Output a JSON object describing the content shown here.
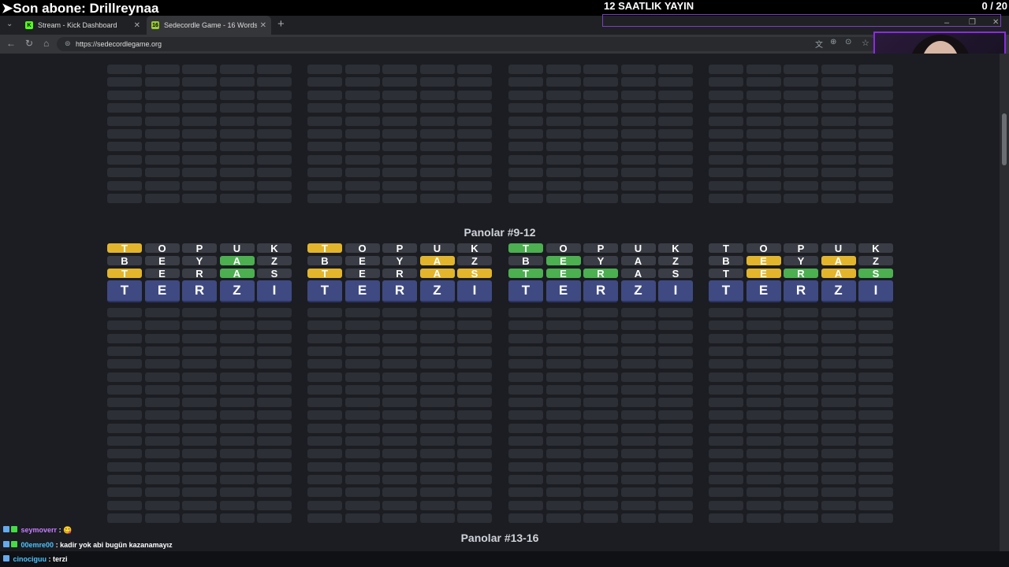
{
  "overlay": {
    "last_sub": "➤Son abone: Drillreynaa",
    "stream_title": "12 SAATLIK YAYIN",
    "counter": "0  / 20",
    "accent": "#8a2be2"
  },
  "browser": {
    "tabs": [
      {
        "label": "Stream - Kick Dashboard",
        "icon": "kick-icon",
        "favicon_text": "K",
        "active": false
      },
      {
        "label": "Sedecordle Game - 16 Words Wo",
        "icon": "sedecordle-icon",
        "favicon_text": "16",
        "active": true
      }
    ],
    "new_tab": "+",
    "url": "https://sedecordlegame.org"
  },
  "game": {
    "section_mid": "Panolar #9-12",
    "section_bottom": "Panolar #13-16",
    "boards": [
      {
        "rows": [
          [
            [
              "T",
              "y"
            ],
            [
              "O",
              "n"
            ],
            [
              "P",
              "n"
            ],
            [
              "U",
              "n"
            ],
            [
              "K",
              "n"
            ]
          ],
          [
            [
              "B",
              "n"
            ],
            [
              "E",
              "n"
            ],
            [
              "Y",
              "n"
            ],
            [
              "A",
              "g"
            ],
            [
              "Z",
              "n"
            ]
          ],
          [
            [
              "T",
              "y"
            ],
            [
              "E",
              "n"
            ],
            [
              "R",
              "n"
            ],
            [
              "A",
              "g"
            ],
            [
              "S",
              "n"
            ]
          ]
        ],
        "current": [
          "T",
          "E",
          "R",
          "Z",
          "I"
        ]
      },
      {
        "rows": [
          [
            [
              "T",
              "y"
            ],
            [
              "O",
              "n"
            ],
            [
              "P",
              "n"
            ],
            [
              "U",
              "n"
            ],
            [
              "K",
              "n"
            ]
          ],
          [
            [
              "B",
              "n"
            ],
            [
              "E",
              "n"
            ],
            [
              "Y",
              "n"
            ],
            [
              "A",
              "y"
            ],
            [
              "Z",
              "n"
            ]
          ],
          [
            [
              "T",
              "y"
            ],
            [
              "E",
              "n"
            ],
            [
              "R",
              "n"
            ],
            [
              "A",
              "y"
            ],
            [
              "S",
              "y"
            ]
          ]
        ],
        "current": [
          "T",
          "E",
          "R",
          "Z",
          "I"
        ]
      },
      {
        "rows": [
          [
            [
              "T",
              "g"
            ],
            [
              "O",
              "n"
            ],
            [
              "P",
              "n"
            ],
            [
              "U",
              "n"
            ],
            [
              "K",
              "n"
            ]
          ],
          [
            [
              "B",
              "n"
            ],
            [
              "E",
              "g"
            ],
            [
              "Y",
              "n"
            ],
            [
              "A",
              "n"
            ],
            [
              "Z",
              "n"
            ]
          ],
          [
            [
              "T",
              "g"
            ],
            [
              "E",
              "g"
            ],
            [
              "R",
              "g"
            ],
            [
              "A",
              "n"
            ],
            [
              "S",
              "n"
            ]
          ]
        ],
        "current": [
          "T",
          "E",
          "R",
          "Z",
          "I"
        ]
      },
      {
        "rows": [
          [
            [
              "T",
              "n"
            ],
            [
              "O",
              "n"
            ],
            [
              "P",
              "n"
            ],
            [
              "U",
              "n"
            ],
            [
              "K",
              "n"
            ]
          ],
          [
            [
              "B",
              "n"
            ],
            [
              "E",
              "y"
            ],
            [
              "Y",
              "n"
            ],
            [
              "A",
              "y"
            ],
            [
              "Z",
              "n"
            ]
          ],
          [
            [
              "T",
              "n"
            ],
            [
              "E",
              "y"
            ],
            [
              "R",
              "g"
            ],
            [
              "A",
              "y"
            ],
            [
              "S",
              "g"
            ]
          ]
        ],
        "current": [
          "T",
          "E",
          "R",
          "Z",
          "I"
        ]
      }
    ]
  },
  "chat": [
    {
      "user": "seymoverr",
      "message": ": 😋"
    },
    {
      "user": "00emre00",
      "message": ": kadir yok abi bugün kazanamayız"
    },
    {
      "user": "cinociguu",
      "message": ": terzi"
    }
  ],
  "colors": {
    "green": "#4caf50",
    "yellow": "#e3b52c",
    "current_row": "#3f4a82"
  }
}
